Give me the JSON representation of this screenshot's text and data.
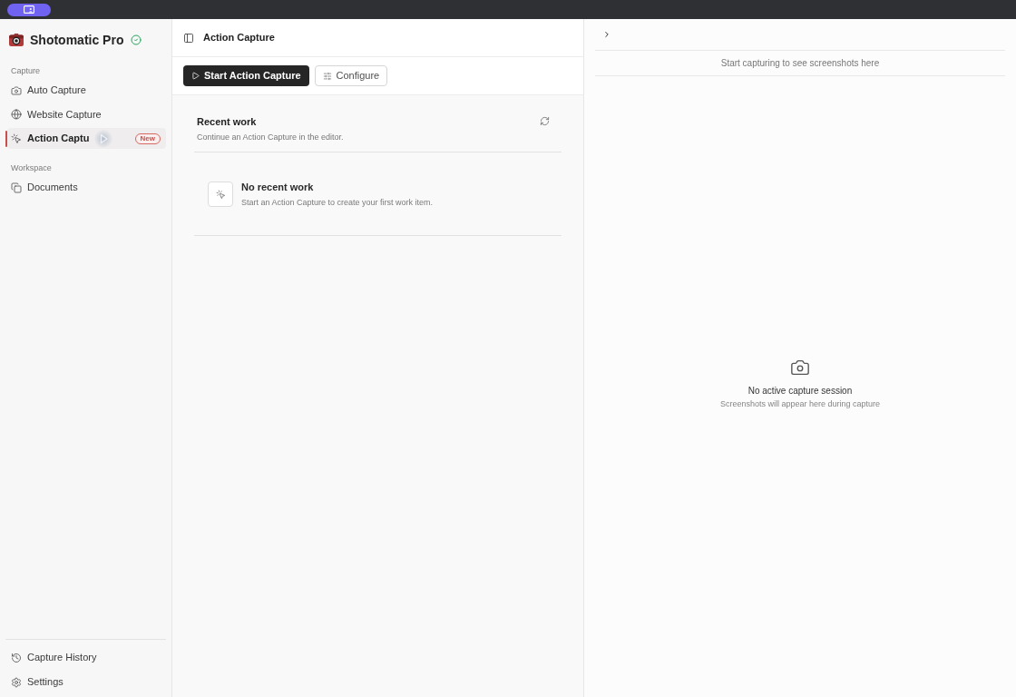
{
  "sidebar": {
    "app_name": "Shotomatic Pro",
    "sections": [
      {
        "label": "Capture",
        "items": [
          {
            "label": "Auto Capture",
            "selected": false
          },
          {
            "label": "Website Capture",
            "selected": false
          },
          {
            "label": "Action Captu",
            "selected": true,
            "badge": "New"
          }
        ]
      },
      {
        "label": "Workspace",
        "items": [
          {
            "label": "Documents",
            "selected": false
          }
        ]
      }
    ],
    "footer_items": [
      {
        "label": "Capture History"
      },
      {
        "label": "Settings"
      }
    ]
  },
  "main": {
    "title": "Action Capture",
    "toolbar": [
      {
        "label": "Start Action Capture",
        "kind": "primary"
      },
      {
        "label": "Configure",
        "kind": "secondary"
      }
    ],
    "recent_work": {
      "title": "Recent work",
      "subtitle": "Continue an Action Capture in the editor.",
      "empty_state": {
        "title": "No recent work",
        "message": "Start an Action Capture to create your first work item."
      }
    }
  },
  "preview_panel": {
    "hint": "Start capturing to see screenshots here",
    "empty_state": {
      "title": "No active capture session",
      "message": "Screenshots will appear here during capture"
    }
  }
}
